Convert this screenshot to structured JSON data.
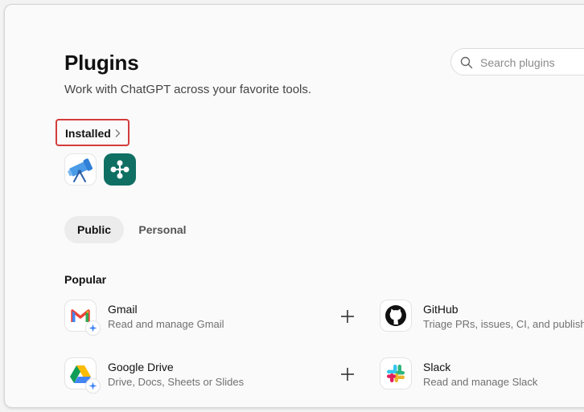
{
  "header": {
    "title": "Plugins",
    "subtitle": "Work with ChatGPT across your favorite tools.",
    "search_placeholder": "Search plugins"
  },
  "installed": {
    "label": "Installed",
    "apps": [
      {
        "icon": "telescope-icon"
      },
      {
        "icon": "network-nodes-icon"
      }
    ]
  },
  "tabs": [
    {
      "label": "Public",
      "selected": true
    },
    {
      "label": "Personal",
      "selected": false
    }
  ],
  "popular": {
    "heading": "Popular",
    "items": [
      {
        "name": "Gmail",
        "description": "Read and manage Gmail",
        "icon": "gmail-icon"
      },
      {
        "name": "GitHub",
        "description": "Triage PRs, issues, CI, and publish fixes",
        "icon": "github-icon"
      },
      {
        "name": "Google Drive",
        "description": "Drive, Docs, Sheets or Slides",
        "icon": "google-drive-icon"
      },
      {
        "name": "Slack",
        "description": "Read and manage Slack",
        "icon": "slack-icon"
      }
    ]
  },
  "colors": {
    "highlight_border": "#d43c3c",
    "installed_green_tile": "#0f6f63",
    "selected_tab_bg": "#ececec"
  }
}
